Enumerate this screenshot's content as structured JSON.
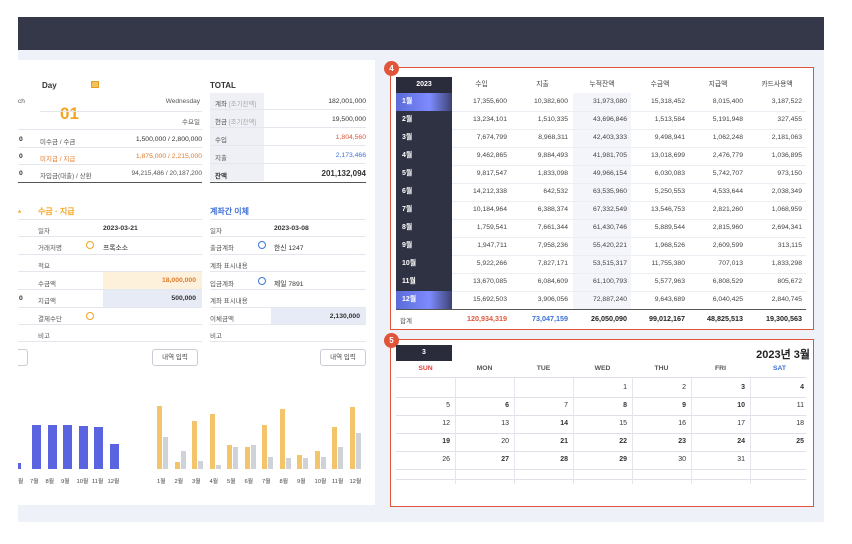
{
  "day_block": {
    "title": "Day",
    "day_number": "01",
    "weekday": "Wednesday",
    "row_label_1": "수요일",
    "rows": [
      {
        "prefix": "0",
        "label": "미수금 / 수금",
        "value": "1,500,000 / 2,800,000"
      },
      {
        "prefix": "0",
        "label": "미지급 / 지급",
        "value": "1,875,000 / 2,215,000"
      },
      {
        "prefix": "0",
        "label": "자입금(대출) / 상환",
        "value": "94,215,486 / 20,187,200"
      }
    ],
    "first_label_fragment": "ch"
  },
  "total_block": {
    "title": "TOTAL",
    "rows": [
      {
        "label": "계좌",
        "sub": "[조기잔액]",
        "value": "182,001,000"
      },
      {
        "label": "현금",
        "sub": "[조기잔액]",
        "value": "19,500,000"
      },
      {
        "label": "수입",
        "sub": "",
        "value": "1,804,560"
      },
      {
        "label": "지출",
        "sub": "",
        "value": "2,173,466"
      },
      {
        "label": "잔액",
        "sub": "",
        "value": "201,132,094"
      }
    ]
  },
  "receive_pay": {
    "title": "수금 · 지급",
    "date_label": "일자",
    "date_value": "2023-03-21",
    "partner_label": "거래처명",
    "partner_value": "프록소소",
    "memo_label": "적요",
    "receipt_label": "수금액",
    "receipt_value": "18,000,000",
    "pay_label": "지급액",
    "pay_value": "500,000",
    "pay_prefix": "0",
    "method_label": "결제수단",
    "note_label": "비고",
    "button": "내역 입력"
  },
  "transfer": {
    "title": "계좌간 이체",
    "date_label": "일자",
    "date_value": "2023-03-08",
    "out_label": "출금계좌",
    "out_value": "한신 1247",
    "out_memo_label": "계좌 표시내용",
    "in_label": "입금계좌",
    "in_value": "제일 7891",
    "in_memo_label": "계좌 표시내용",
    "amount_label": "이체금액",
    "amount_value": "2,130,000",
    "note_label": "비고",
    "button": "내역 입력"
  },
  "chart_left": {
    "type": "bar",
    "categories": [
      "7월",
      "8월",
      "9월",
      "10월",
      "11월",
      "12월"
    ],
    "values": [
      44,
      44,
      44,
      43,
      42,
      25
    ],
    "color": "#5a63e0"
  },
  "chart_right": {
    "type": "bar",
    "categories": [
      "1월",
      "2월",
      "3월",
      "4월",
      "5월",
      "6월",
      "7월",
      "8월",
      "9월",
      "10월",
      "11월",
      "12월"
    ],
    "series": [
      {
        "color": "#f4c46a",
        "values": [
          63,
          7,
          48,
          55,
          24,
          22,
          44,
          60,
          14,
          18,
          42,
          62
        ]
      },
      {
        "color": "#cfd2d8",
        "values": [
          32,
          18,
          8,
          4,
          22,
          24,
          12,
          11,
          11,
          12,
          22,
          36
        ]
      }
    ]
  },
  "annual_table": {
    "badge": "4",
    "year": "2023",
    "columns": [
      "수입",
      "지출",
      "누적잔액",
      "수금액",
      "지급액",
      "카드사용액"
    ],
    "months": [
      "1월",
      "2월",
      "3월",
      "4월",
      "5월",
      "6월",
      "7월",
      "8월",
      "9월",
      "10월",
      "11월",
      "12월"
    ],
    "rows": [
      [
        "17,355,600",
        "10,382,600",
        "31,973,080",
        "15,318,452",
        "8,015,400",
        "3,187,522"
      ],
      [
        "13,234,101",
        "1,510,335",
        "43,696,846",
        "1,513,584",
        "5,191,948",
        "327,455"
      ],
      [
        "7,674,799",
        "8,968,311",
        "42,403,333",
        "9,498,941",
        "1,062,248",
        "2,181,063"
      ],
      [
        "9,462,865",
        "9,884,493",
        "41,981,705",
        "13,018,699",
        "2,476,779",
        "1,036,895"
      ],
      [
        "9,817,547",
        "1,833,098",
        "49,966,154",
        "6,030,083",
        "5,742,707",
        "973,150"
      ],
      [
        "14,212,338",
        "642,532",
        "63,535,960",
        "5,250,553",
        "4,533,644",
        "2,038,349"
      ],
      [
        "10,184,964",
        "6,388,374",
        "67,332,549",
        "13,546,753",
        "2,821,260",
        "1,068,959"
      ],
      [
        "1,759,541",
        "7,661,344",
        "61,430,746",
        "5,889,544",
        "2,815,960",
        "2,694,341"
      ],
      [
        "1,947,711",
        "7,958,236",
        "55,420,221",
        "1,968,526",
        "2,609,599",
        "313,115"
      ],
      [
        "5,922,266",
        "7,827,171",
        "53,515,317",
        "11,755,380",
        "707,013",
        "1,833,298"
      ],
      [
        "13,670,085",
        "6,084,609",
        "61,100,793",
        "5,577,963",
        "6,808,529",
        "805,672"
      ],
      [
        "15,692,503",
        "3,906,056",
        "72,887,240",
        "9,643,689",
        "6,040,425",
        "2,840,745"
      ]
    ],
    "total_label": "합계",
    "totals": [
      "120,934,319",
      "73,047,159",
      "26,050,090",
      "99,012,167",
      "48,825,513",
      "19,300,563"
    ],
    "total_colors": [
      "#e0553a",
      "#3d6fd6",
      "#222",
      "#222",
      "#222",
      "#222"
    ]
  },
  "calendar": {
    "badge": "5",
    "month_num": "3",
    "title": "2023년 3월",
    "weekdays": [
      "SUN",
      "MON",
      "TUE",
      "WED",
      "THU",
      "FRI",
      "SAT"
    ],
    "weekday_colors": [
      "#e0443a",
      "#555",
      "#555",
      "#555",
      "#555",
      "#555",
      "#3d6fd6"
    ],
    "weeks": [
      [
        "",
        "",
        "",
        "1",
        "2",
        "3",
        "4"
      ],
      [
        "5",
        "6",
        "7",
        "8",
        "9",
        "10",
        "11"
      ],
      [
        "12",
        "13",
        "14",
        "15",
        "16",
        "17",
        "18"
      ],
      [
        "19",
        "20",
        "21",
        "22",
        "23",
        "24",
        "25"
      ],
      [
        "26",
        "27",
        "28",
        "29",
        "30",
        "31",
        ""
      ]
    ],
    "bold_dates": [
      "3",
      "4",
      "6",
      "8",
      "9",
      "10",
      "14",
      "19",
      "21",
      "22",
      "23",
      "24",
      "25",
      "27",
      "28",
      "29"
    ]
  }
}
